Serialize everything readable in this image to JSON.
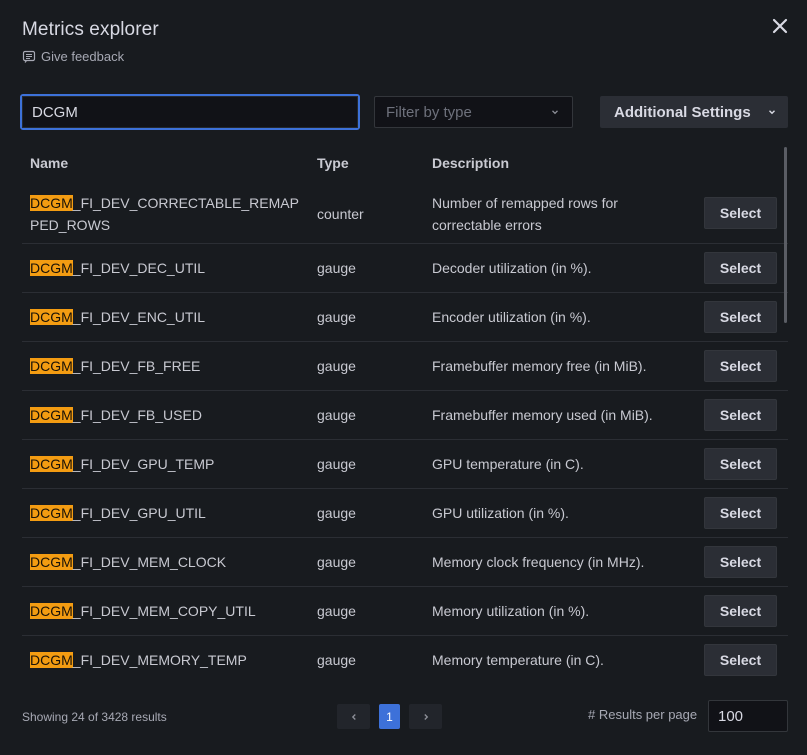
{
  "header": {
    "title": "Metrics explorer",
    "feedback_label": "Give feedback"
  },
  "search": {
    "value": "DCGM"
  },
  "filter": {
    "placeholder": "Filter by type"
  },
  "settings": {
    "label": "Additional Settings"
  },
  "table": {
    "headers": {
      "name": "Name",
      "type": "Type",
      "description": "Description"
    },
    "highlight": "DCGM",
    "select_label": "Select",
    "rows": [
      {
        "name_match": "DCGM",
        "name_rest": "_FI_DEV_CORRECTABLE_REMAPPED_ROWS",
        "type": "counter",
        "description": "Number of remapped rows for correctable errors"
      },
      {
        "name_match": "DCGM",
        "name_rest": "_FI_DEV_DEC_UTIL",
        "type": "gauge",
        "description": "Decoder utilization (in %)."
      },
      {
        "name_match": "DCGM",
        "name_rest": "_FI_DEV_ENC_UTIL",
        "type": "gauge",
        "description": "Encoder utilization (in %)."
      },
      {
        "name_match": "DCGM",
        "name_rest": "_FI_DEV_FB_FREE",
        "type": "gauge",
        "description": "Framebuffer memory free (in MiB)."
      },
      {
        "name_match": "DCGM",
        "name_rest": "_FI_DEV_FB_USED",
        "type": "gauge",
        "description": "Framebuffer memory used (in MiB)."
      },
      {
        "name_match": "DCGM",
        "name_rest": "_FI_DEV_GPU_TEMP",
        "type": "gauge",
        "description": "GPU temperature (in C)."
      },
      {
        "name_match": "DCGM",
        "name_rest": "_FI_DEV_GPU_UTIL",
        "type": "gauge",
        "description": "GPU utilization (in %)."
      },
      {
        "name_match": "DCGM",
        "name_rest": "_FI_DEV_MEM_CLOCK",
        "type": "gauge",
        "description": "Memory clock frequency (in MHz)."
      },
      {
        "name_match": "DCGM",
        "name_rest": "_FI_DEV_MEM_COPY_UTIL",
        "type": "gauge",
        "description": "Memory utilization (in %)."
      },
      {
        "name_match": "DCGM",
        "name_rest": "_FI_DEV_MEMORY_TEMP",
        "type": "gauge",
        "description": "Memory temperature (in C)."
      }
    ]
  },
  "footer": {
    "status": "Showing 24 of 3428 results",
    "current_page": "1",
    "per_page_label": "# Results per page",
    "per_page_value": "100"
  },
  "colors": {
    "accent": "#3d71d9",
    "highlight": "#f39c12",
    "background": "#181b1f"
  },
  "icons": [
    "close-icon",
    "feedback-icon",
    "chevron-down-icon",
    "chevron-left-icon",
    "chevron-right-icon"
  ]
}
